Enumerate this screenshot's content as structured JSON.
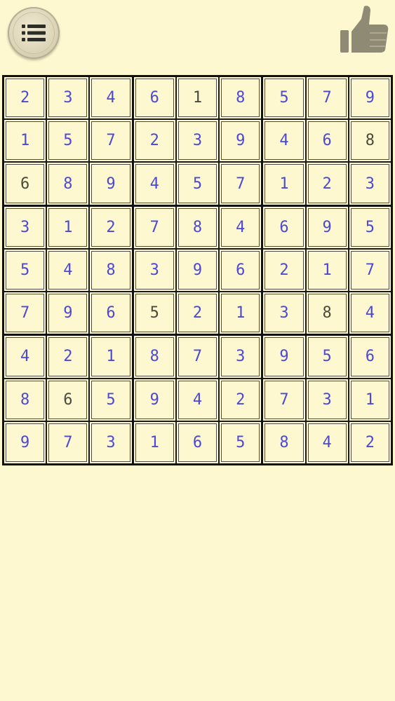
{
  "toolbar": {
    "menu_icon": "list-icon",
    "like_icon": "thumbs-up-icon"
  },
  "colors": {
    "background": "#fdf8cf",
    "user_digit": "#4b48d8",
    "given_digit": "#4a4a3c",
    "grid_line": "#111111"
  },
  "board": {
    "rows": [
      [
        "2",
        "3",
        "4",
        "6",
        "1",
        "8",
        "5",
        "7",
        "9"
      ],
      [
        "1",
        "5",
        "7",
        "2",
        "3",
        "9",
        "4",
        "6",
        "8"
      ],
      [
        "6",
        "8",
        "9",
        "4",
        "5",
        "7",
        "1",
        "2",
        "3"
      ],
      [
        "3",
        "1",
        "2",
        "7",
        "8",
        "4",
        "6",
        "9",
        "5"
      ],
      [
        "5",
        "4",
        "8",
        "3",
        "9",
        "6",
        "2",
        "1",
        "7"
      ],
      [
        "7",
        "9",
        "6",
        "5",
        "2",
        "1",
        "3",
        "8",
        "4"
      ],
      [
        "4",
        "2",
        "1",
        "8",
        "7",
        "3",
        "9",
        "5",
        "6"
      ],
      [
        "8",
        "6",
        "5",
        "9",
        "4",
        "2",
        "7",
        "3",
        "1"
      ],
      [
        "9",
        "7",
        "3",
        "1",
        "6",
        "5",
        "8",
        "4",
        "2"
      ]
    ],
    "given": [
      [
        0,
        4
      ],
      [
        1,
        8
      ],
      [
        2,
        0
      ],
      [
        5,
        3
      ],
      [
        5,
        7
      ],
      [
        7,
        1
      ]
    ]
  }
}
